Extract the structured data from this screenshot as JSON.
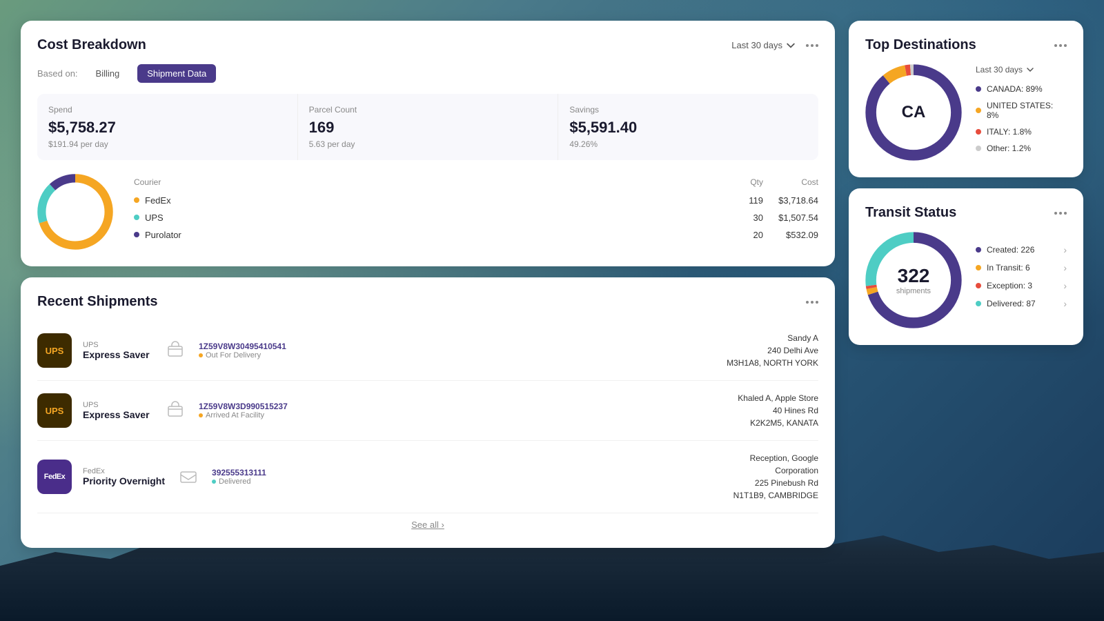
{
  "background": {
    "description": "Night sky with mountain silhouette"
  },
  "cost_breakdown": {
    "title": "Cost Breakdown",
    "period_label": "Last 30 days",
    "based_on_label": "Based on:",
    "tabs": [
      {
        "id": "billing",
        "label": "Billing",
        "active": false
      },
      {
        "id": "shipment",
        "label": "Shipment Data",
        "active": true
      }
    ],
    "metrics": {
      "spend": {
        "label": "Spend",
        "value": "$5,758.27",
        "sub": "$191.94 per day"
      },
      "parcel_count": {
        "label": "Parcel Count",
        "value": "169",
        "sub": "5.63 per day"
      },
      "savings": {
        "label": "Savings",
        "value": "$5,591.40",
        "sub": "49.26%"
      }
    },
    "courier_header": {
      "courier": "Courier",
      "qty": "Qty",
      "cost": "Cost"
    },
    "couriers": [
      {
        "name": "FedEx",
        "qty": "119",
        "cost": "$3,718.64",
        "color": "#f5a623",
        "percent": 70
      },
      {
        "name": "UPS",
        "qty": "30",
        "cost": "$1,507.54",
        "color": "#4ecdc4",
        "percent": 18
      },
      {
        "name": "Purolator",
        "qty": "20",
        "cost": "$532.09",
        "color": "#4a3a8a",
        "percent": 12
      }
    ]
  },
  "recent_shipments": {
    "title": "Recent Shipments",
    "see_all_label": "See all",
    "shipments": [
      {
        "carrier": "UPS",
        "carrier_type": "ups",
        "service": "Express Saver",
        "tracking_number": "1Z59V8W30495410541",
        "status": "Out For Delivery",
        "status_color": "#f5a623",
        "icon_type": "box",
        "recipient_name": "Sandy A",
        "recipient_address": "240 Delhi Ave",
        "recipient_city": "M3H1A8, NORTH YORK"
      },
      {
        "carrier": "UPS",
        "carrier_type": "ups",
        "service": "Express Saver",
        "tracking_number": "1Z59V8W3D990515237",
        "status": "Arrived At Facility",
        "status_color": "#f5a623",
        "icon_type": "box",
        "recipient_name": "Khaled A, Apple Store",
        "recipient_address": "40 Hines Rd",
        "recipient_city": "K2K2M5, KANATA"
      },
      {
        "carrier": "FedEx",
        "carrier_type": "fedex",
        "service": "Priority Overnight",
        "tracking_number": "392555313111",
        "status": "Delivered",
        "status_color": "#4ecdc4",
        "icon_type": "envelope",
        "recipient_name": "Reception, Google",
        "recipient_name2": "Corporation",
        "recipient_address": "225 Pinebush Rd",
        "recipient_city": "N1T1B9, CAMBRIDGE"
      }
    ]
  },
  "top_destinations": {
    "title": "Top Destinations",
    "period_label": "Last 30 days",
    "center_label": "CA",
    "legend": [
      {
        "label": "CANADA: 89%",
        "color": "#4a3a8a",
        "percent": 89
      },
      {
        "label": "UNITED STATES: 8%",
        "color": "#f5a623",
        "percent": 8
      },
      {
        "label": "ITALY: 1.8%",
        "color": "#e74c3c",
        "percent": 1.8
      },
      {
        "label": "Other: 1.2%",
        "color": "#ccc",
        "percent": 1.2
      }
    ]
  },
  "transit_status": {
    "title": "Transit Status",
    "center_number": "322",
    "center_text": "shipments",
    "legend": [
      {
        "label": "Created: 226",
        "color": "#4a3a8a",
        "percent": 70
      },
      {
        "label": "In Transit: 6",
        "color": "#f5a623",
        "percent": 2
      },
      {
        "label": "Exception: 3",
        "color": "#e74c3c",
        "percent": 1
      },
      {
        "label": "Delivered: 87",
        "color": "#4ecdc4",
        "percent": 27
      }
    ]
  }
}
